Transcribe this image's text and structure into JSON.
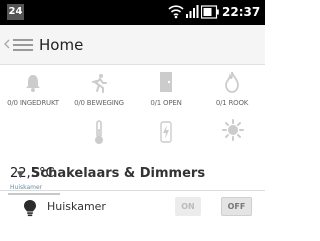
{
  "status_bar": {
    "notification_count": "24",
    "time": "22:37",
    "icons": [
      "wifi-icon",
      "signal-icon",
      "battery-icon"
    ]
  },
  "action_bar": {
    "title": "Home",
    "icons": [
      "up-icon",
      "drawer-icon"
    ]
  },
  "sensors": [
    {
      "icon": "bell-icon",
      "label": "0/0 INGEDRUKT"
    },
    {
      "icon": "motion-icon",
      "label": "0/0 BEWEGING"
    },
    {
      "icon": "door-icon",
      "label": "0/1 OPEN"
    },
    {
      "icon": "flame-icon",
      "label": "0/1 ROOK"
    }
  ],
  "climate": {
    "temperature": "22,5°C",
    "location": "Huiskamer",
    "icons": [
      "thermometer-icon",
      "power-icon",
      "sun-icon"
    ]
  },
  "section": {
    "title": "Schakelaars & Dimmers"
  },
  "switches": [
    {
      "icon": "bulb-icon",
      "label": "Huiskamer",
      "on_label": "ON",
      "off_label": "OFF",
      "state": "off"
    }
  ],
  "colors": {
    "status_bar": "#000000",
    "action_bar": "#f5f5f5",
    "icon_gray": "#cccccc",
    "location_label": "#6a8da0"
  }
}
